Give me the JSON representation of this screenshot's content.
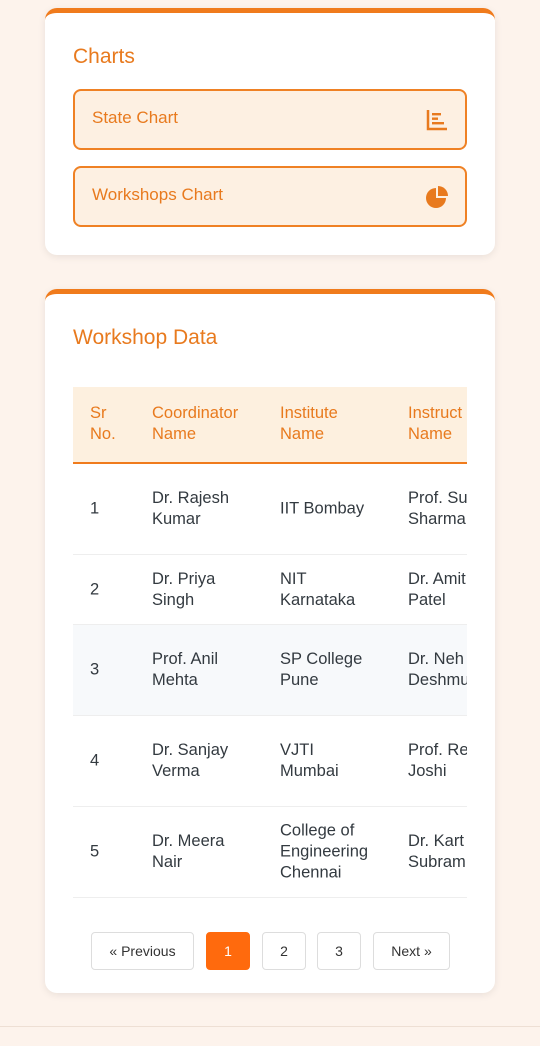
{
  "charts": {
    "title": "Charts",
    "buttons": [
      {
        "label": "State Chart",
        "icon": "bar-chart-icon"
      },
      {
        "label": "Workshops Chart",
        "icon": "pie-chart-icon"
      }
    ]
  },
  "workshop": {
    "title": "Workshop Data",
    "headers": {
      "sr": [
        "Sr",
        "No."
      ],
      "coordinator": [
        "Coordinator",
        "Name"
      ],
      "institute": [
        "Institute",
        "Name"
      ],
      "instructor": [
        "Instruct",
        "Name"
      ]
    },
    "rows": [
      {
        "sr": "1",
        "coordinator": [
          "Dr. Rajesh",
          "Kumar"
        ],
        "institute": [
          "IIT Bombay"
        ],
        "instructor": [
          "Prof. Su",
          "Sharma"
        ]
      },
      {
        "sr": "2",
        "coordinator": [
          "Dr. Priya",
          "Singh"
        ],
        "institute": [
          "NIT",
          "Karnataka"
        ],
        "instructor": [
          "Dr. Amit",
          "Patel"
        ]
      },
      {
        "sr": "3",
        "coordinator": [
          "Prof. Anil",
          "Mehta"
        ],
        "institute": [
          "SP College",
          "Pune"
        ],
        "instructor": [
          "Dr. Neh",
          "Deshmu"
        ]
      },
      {
        "sr": "4",
        "coordinator": [
          "Dr. Sanjay",
          "Verma"
        ],
        "institute": [
          "VJTI",
          "Mumbai"
        ],
        "instructor": [
          "Prof. Re",
          "Joshi"
        ]
      },
      {
        "sr": "5",
        "coordinator": [
          "Dr. Meera",
          "Nair"
        ],
        "institute": [
          "College of",
          "Engineering",
          "Chennai"
        ],
        "instructor": [
          "Dr. Kart",
          "Subram"
        ]
      }
    ]
  },
  "pagination": {
    "prev": "« Previous",
    "pages": [
      "1",
      "2",
      "3"
    ],
    "active": "1",
    "next": "Next »"
  },
  "colors": {
    "accent": "#f07b1c",
    "active_page": "#ff6a0d"
  }
}
